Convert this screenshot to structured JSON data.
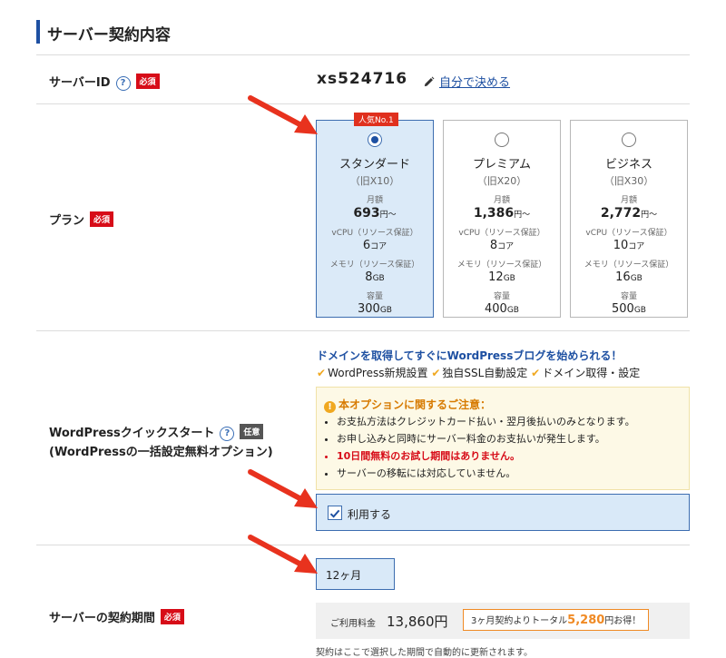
{
  "section": {
    "title": "サーバー契約内容"
  },
  "badges": {
    "required": "必須",
    "optional": "任意"
  },
  "server_id": {
    "label": "サーバーID",
    "value": "xs524716",
    "edit_link": "自分で決める"
  },
  "plan": {
    "label": "プラン",
    "popular_badge": "人気No.1",
    "price_label": "月額",
    "vcpu_label": "vCPU（リソース保証）",
    "memory_label": "メモリ（リソース保証）",
    "capacity_label": "容量",
    "options": [
      {
        "name": "スタンダード",
        "old": "（旧X10）",
        "price": "693",
        "price_unit": "円〜",
        "vcpu": "6",
        "vcpu_unit": "コア",
        "memory": "8",
        "memory_unit": "GB",
        "capacity": "300",
        "capacity_unit": "GB",
        "selected": true
      },
      {
        "name": "プレミアム",
        "old": "（旧X20）",
        "price": "1,386",
        "price_unit": "円〜",
        "vcpu": "8",
        "vcpu_unit": "コア",
        "memory": "12",
        "memory_unit": "GB",
        "capacity": "400",
        "capacity_unit": "GB",
        "selected": false
      },
      {
        "name": "ビジネス",
        "old": "（旧X30）",
        "price": "2,772",
        "price_unit": "円〜",
        "vcpu": "10",
        "vcpu_unit": "コア",
        "memory": "16",
        "memory_unit": "GB",
        "capacity": "500",
        "capacity_unit": "GB",
        "selected": false
      }
    ]
  },
  "wp": {
    "label_line1": "WordPressクイックスタート",
    "label_line2": "(WordPressの一括設定無料オプション)",
    "headline": "ドメインを取得してすぐにWordPressブログを始められる！",
    "features": [
      "WordPress新規設置",
      "独自SSL自動設定",
      "ドメイン取得・設定"
    ],
    "notice_title": "本オプションに関するご注意：",
    "notice_items": [
      "お支払方法はクレジットカード払い・翌月後払いのみとなります。",
      "お申し込みと同時にサーバー料金のお支払いが発生します。",
      "10日間無料のお試し期間はありません。",
      "サーバーの移転には対応していません。"
    ],
    "use_label": "利用する",
    "use_checked": true
  },
  "period": {
    "label": "サーバーの契約期間",
    "selected": "12ヶ月",
    "fee_label": "ご利用料金",
    "fee_value": "13,860円",
    "promo_prefix": "3ヶ月契約よりトータル",
    "promo_amount": "5,280",
    "promo_suffix": "円お得！",
    "note": "契約はここで選択した期間で自動的に更新されます。"
  },
  "colors": {
    "accent": "#1e50a2",
    "required": "#d70c18",
    "arrow": "#e8321e",
    "promo": "#f08a24"
  }
}
